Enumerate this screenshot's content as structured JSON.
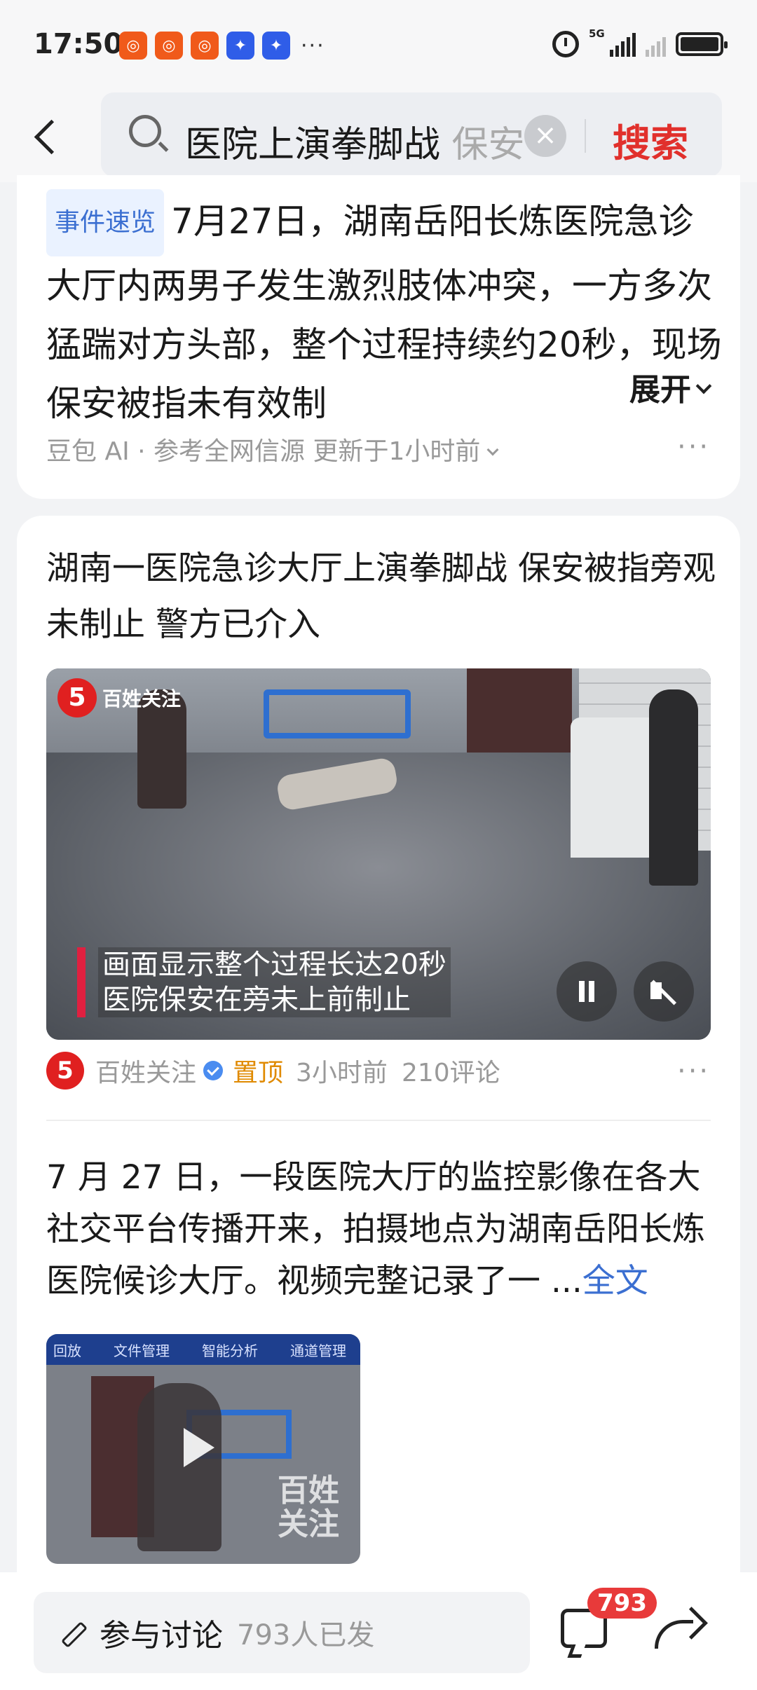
{
  "status_bar": {
    "time": "17:50",
    "notification_icons": [
      "orange-app-icon",
      "orange-app-icon",
      "orange-app-icon",
      "blue-app-icon",
      "blue-app-icon"
    ],
    "more": "···",
    "network": "5G",
    "battery_icon": "battery-icon",
    "alarm_icon": "alarm-icon"
  },
  "search": {
    "query": "医院上演拳脚战",
    "query_overflow": "保安",
    "button_label": "搜索"
  },
  "summary_card": {
    "tag": "事件速览",
    "text": "7月27日，湖南岳阳长炼医院急诊大厅内两男子发生激烈肢体冲突，一方多次猛踹对方头部，整个过程持续约20秒，现场保安被指未有效制",
    "expand_label": "展开",
    "source": "豆包 AI · 参考全网信源 更新于1小时前",
    "more": "···"
  },
  "news_item": {
    "title": "湖南一医院急诊大厅上演拳脚战 保安被指旁观未制止 警方已介入",
    "video": {
      "logo_name": "百姓关注",
      "caption_line1": "画面显示整个过程长达20秒",
      "caption_line2": "医院保安在旁未上前制止"
    },
    "author": "百姓关注",
    "pinned": "置顶",
    "time": "3小时前",
    "comments": "210评论",
    "more": "···"
  },
  "article": {
    "text": "7 月 27 日，一段医院大厅的监控影像在各大社交平台传播开来，拍摄地点为湖南岳阳长炼医院候诊大厅。视频完整记录了一 ...",
    "full_label": "全文",
    "thumb_tabs": [
      "回放",
      "文件管理",
      "智能分析",
      "通道管理"
    ],
    "thumb_watermark": "百姓\n关注"
  },
  "bottom_bar": {
    "discuss_label": "参与讨论",
    "discuss_count": "793人已发",
    "comment_badge": "793"
  },
  "colors": {
    "accent_red": "#e1302c",
    "link_blue": "#3b6fd1",
    "pin_orange": "#e08a00"
  }
}
